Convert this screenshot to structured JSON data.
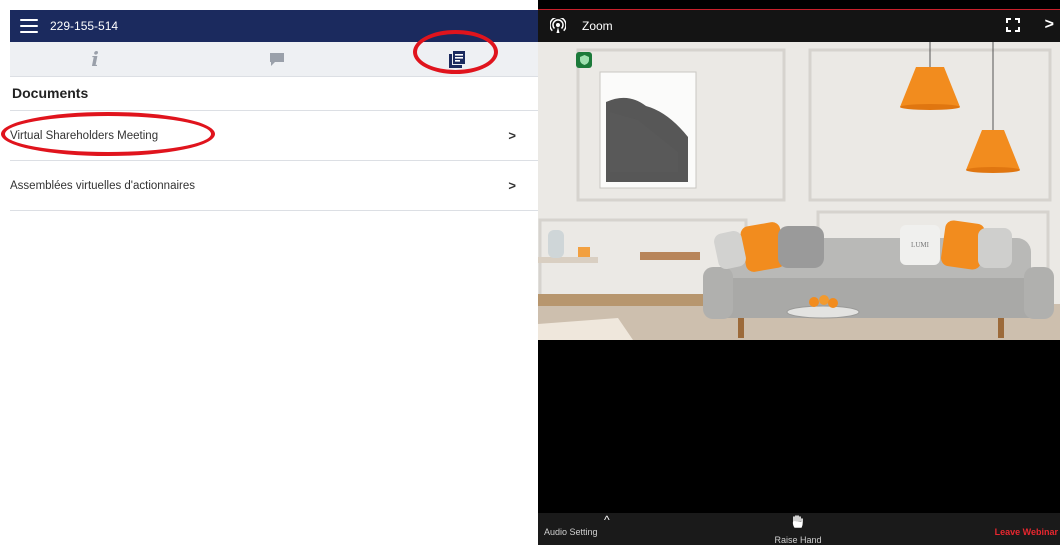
{
  "left_panel": {
    "meeting_id": "229-155-514",
    "info_tab_glyph": "i",
    "section_title": "Documents",
    "documents": [
      {
        "label": "Virtual Shareholders Meeting",
        "chevron": ">"
      },
      {
        "label": "Assemblées virtuelles d'actionnaires",
        "chevron": ">"
      }
    ],
    "icons": {
      "menu": "hamburger-menu-icon",
      "info": "info-icon",
      "chat": "chat-icon",
      "documents": "documents-icon"
    },
    "colors": {
      "header": "#1b2a5e",
      "highlight_circle": "#e0141d"
    }
  },
  "zoom_panel": {
    "title": "Zoom",
    "next_glyph": ">",
    "video_logo_text": "LUMI",
    "bottom_bar": {
      "audio_setting": "Audio Setting",
      "audio_caret": "^",
      "raise_hand": "Raise Hand",
      "leave_webinar": "Leave Webinar"
    },
    "icons": {
      "cast": "broadcast-icon",
      "fullscreen": "fullscreen-icon",
      "shield": "security-shield-icon",
      "hand": "raise-hand-icon"
    },
    "colors": {
      "leave": "#e8272f",
      "shield": "#1c7a3a",
      "accent_orange": "#f28c1e"
    }
  }
}
